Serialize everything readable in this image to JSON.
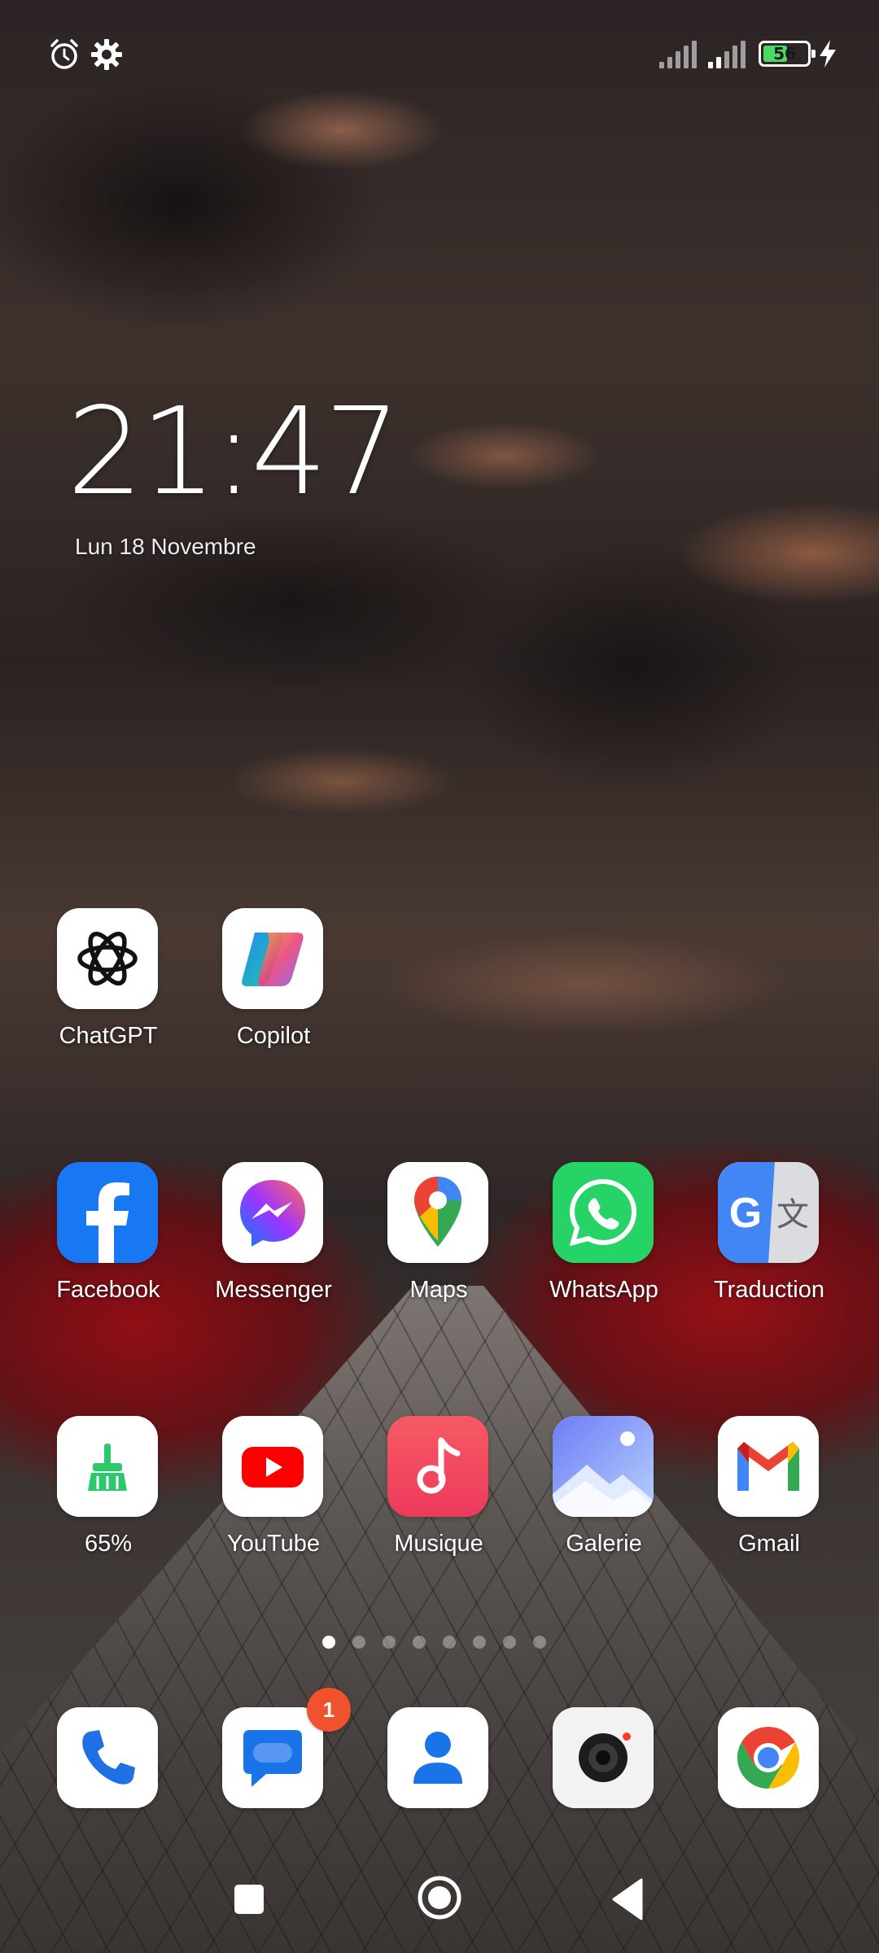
{
  "status_bar": {
    "battery_level": "56",
    "battery_fraction": 0.56,
    "battery_color": "#4cd964",
    "left_icons": [
      "alarm-icon",
      "settings-icon"
    ],
    "right_icons": [
      "signal-icon",
      "signal-icon",
      "battery-icon",
      "charging-icon"
    ]
  },
  "clock": {
    "time": "21:47",
    "date": "Lun 18 Novembre"
  },
  "apps": {
    "chatgpt": "ChatGPT",
    "copilot": "Copilot",
    "facebook": "Facebook",
    "messenger": "Messenger",
    "maps": "Maps",
    "whatsapp": "WhatsApp",
    "traduction": "Traduction",
    "cleaner": "65%",
    "youtube": "YouTube",
    "musique": "Musique",
    "galerie": "Galerie",
    "gmail": "Gmail"
  },
  "dock": {
    "messages_badge": "1",
    "icons": [
      "phone-icon",
      "messages-icon",
      "contacts-icon",
      "camera-icon",
      "chrome-icon"
    ]
  },
  "page_indicator": {
    "total_pages": 8,
    "active_page": 1
  },
  "nav_bar": {
    "icons": [
      "recents-icon",
      "home-icon",
      "back-icon"
    ]
  },
  "colors": {
    "facebook_blue": "#1877f2",
    "whatsapp_green": "#25d366",
    "youtube_red": "#ff0000",
    "music_red": "#f2455e",
    "badge_orange": "#f0522d"
  }
}
